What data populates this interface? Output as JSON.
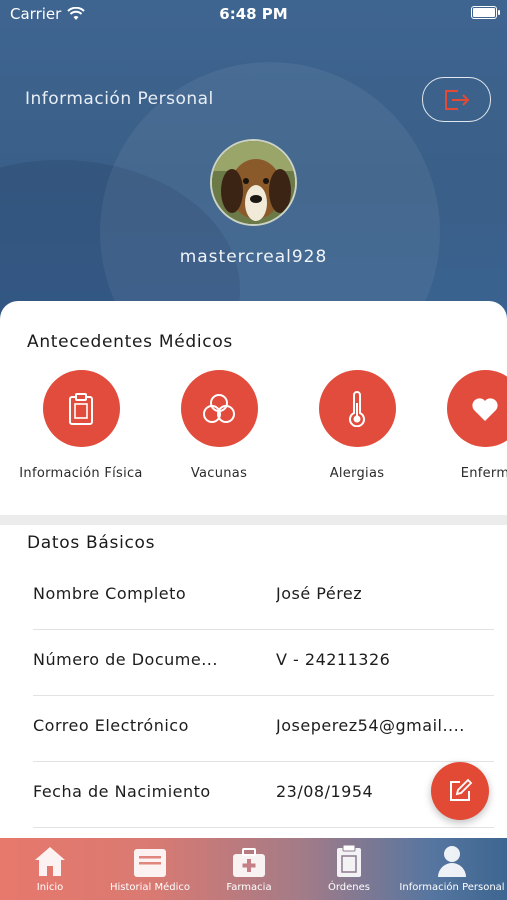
{
  "status_bar": {
    "carrier": "Carrier",
    "time": "6:48 PM"
  },
  "header": {
    "title": "Información Personal",
    "username": "mastercreal928"
  },
  "medical_history": {
    "title": "Antecedentes Médicos",
    "items": [
      {
        "label": "Información Física",
        "icon": "clipboard-icon"
      },
      {
        "label": "Vacunas",
        "icon": "vaccine-rings-icon"
      },
      {
        "label": "Alergias",
        "icon": "thermometer-icon"
      },
      {
        "label": "Enferm",
        "icon": "heart-icon"
      }
    ]
  },
  "basic_data": {
    "title": "Datos Básicos",
    "rows": [
      {
        "key": "Nombre Completo",
        "value": "José Pérez"
      },
      {
        "key": "Número de Docume...",
        "value": "V - 24211326"
      },
      {
        "key": "Correo Electrónico",
        "value": "Joseperez54@gmail...."
      },
      {
        "key": "Fecha de Nacimiento",
        "value": "23/08/1954"
      }
    ]
  },
  "tabbar": {
    "tabs": [
      {
        "label": "Inicio",
        "icon": "home-icon"
      },
      {
        "label": "Historial Médico",
        "icon": "medical-record-icon"
      },
      {
        "label": "Farmacia",
        "icon": "first-aid-kit-icon"
      },
      {
        "label": "Órdenes",
        "icon": "clipboard-icon"
      },
      {
        "label": "Información Personal",
        "icon": "person-icon"
      }
    ]
  },
  "colors": {
    "accent": "#e14c3c",
    "header_blue": "#3e6590"
  }
}
